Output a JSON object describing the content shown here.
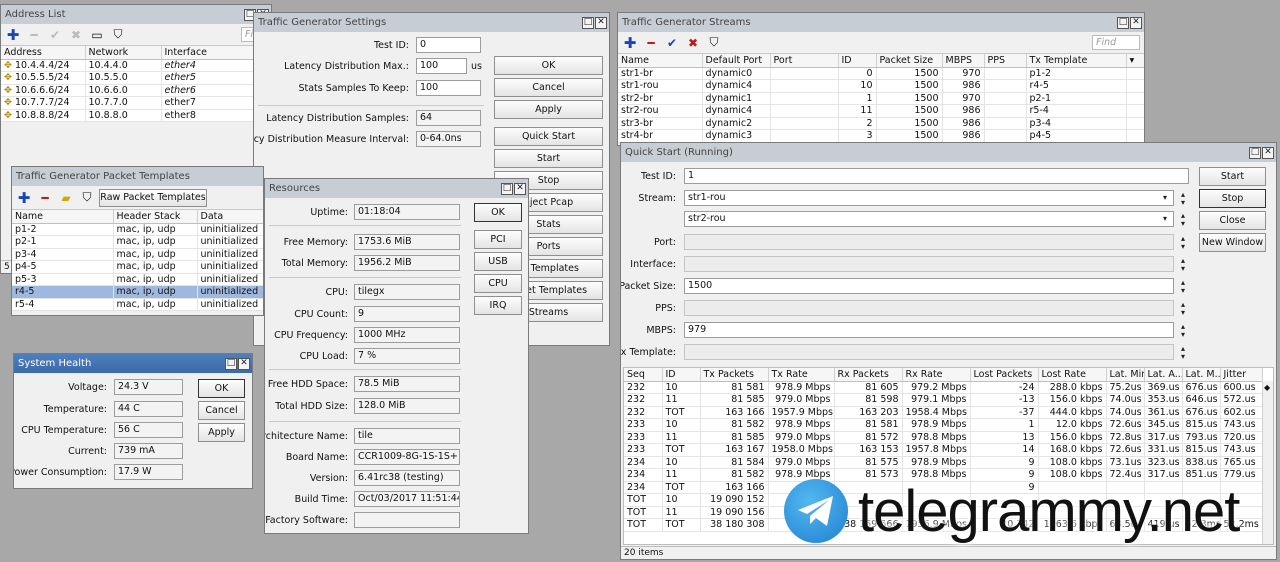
{
  "address_list": {
    "title": "Address List",
    "find": "Find",
    "columns": [
      "Address",
      "Network",
      "Interface"
    ],
    "rows": [
      {
        "address": "10.4.4.4/24",
        "network": "10.4.4.0",
        "interface": "ether4"
      },
      {
        "address": "10.5.5.5/24",
        "network": "10.5.5.0",
        "interface": "ether5"
      },
      {
        "address": "10.6.6.6/24",
        "network": "10.6.6.0",
        "interface": "ether6"
      },
      {
        "address": "10.7.7.7/24",
        "network": "10.7.7.0",
        "interface": "ether7"
      },
      {
        "address": "10.8.8.8/24",
        "network": "10.8.8.0",
        "interface": "ether8"
      }
    ],
    "status_char": "5"
  },
  "tg_settings": {
    "title": "Traffic Generator Settings",
    "test_id_label": "Test ID:",
    "test_id": "0",
    "latency_max_label": "Latency Distribution Max.:",
    "latency_max": "100",
    "latency_max_unit": "us",
    "stats_samples_label": "Stats Samples To Keep:",
    "stats_samples": "100",
    "latency_samples_label": "Latency Distribution Samples:",
    "latency_samples": "64",
    "latency_interval_label": "Latency Distribution Measure Interval:",
    "latency_interval": "0-64.0ns",
    "buttons": {
      "ok": "OK",
      "cancel": "Cancel",
      "apply": "Apply",
      "quick_start": "Quick Start",
      "start": "Start",
      "stop": "Stop",
      "inject_pcap": "nject Pcap",
      "stats": "Stats",
      "ports": "Ports",
      "packet_templates": "et Templates",
      "raw_packet_templates": "acket Templates",
      "streams": "Streams"
    }
  },
  "tg_streams": {
    "title": "Traffic Generator Streams",
    "find": "Find",
    "columns": [
      "Name",
      "Default Port",
      "Port",
      "ID",
      "Packet Size",
      "MBPS",
      "PPS",
      "Tx Template"
    ],
    "rows": [
      {
        "name": "str1-br",
        "default_port": "dynamic0",
        "port": "",
        "id": "0",
        "size": "1500",
        "mbps": "970",
        "pps": "",
        "tpl": "p1-2"
      },
      {
        "name": "str1-rou",
        "default_port": "dynamic4",
        "port": "",
        "id": "10",
        "size": "1500",
        "mbps": "986",
        "pps": "",
        "tpl": "r4-5"
      },
      {
        "name": "str2-br",
        "default_port": "dynamic1",
        "port": "",
        "id": "1",
        "size": "1500",
        "mbps": "970",
        "pps": "",
        "tpl": "p2-1"
      },
      {
        "name": "str2-rou",
        "default_port": "dynamic4",
        "port": "",
        "id": "11",
        "size": "1500",
        "mbps": "986",
        "pps": "",
        "tpl": "r5-4"
      },
      {
        "name": "str3-br",
        "default_port": "dynamic2",
        "port": "",
        "id": "2",
        "size": "1500",
        "mbps": "986",
        "pps": "",
        "tpl": "p3-4"
      },
      {
        "name": "str4-br",
        "default_port": "dynamic3",
        "port": "",
        "id": "3",
        "size": "1500",
        "mbps": "986",
        "pps": "",
        "tpl": "p4-5"
      }
    ]
  },
  "packet_templates": {
    "title": "Traffic Generator Packet Templates",
    "raw_button": "Raw Packet Templates",
    "columns": [
      "Name",
      "Header Stack",
      "Data"
    ],
    "rows": [
      {
        "name": "p1-2",
        "stack": "mac, ip, udp",
        "data": "uninitialized"
      },
      {
        "name": "p2-1",
        "stack": "mac, ip, udp",
        "data": "uninitialized"
      },
      {
        "name": "p3-4",
        "stack": "mac, ip, udp",
        "data": "uninitialized"
      },
      {
        "name": "p4-5",
        "stack": "mac, ip, udp",
        "data": "uninitialized"
      },
      {
        "name": "p5-3",
        "stack": "mac, ip, udp",
        "data": "uninitialized"
      },
      {
        "name": "r4-5",
        "stack": "mac, ip, udp",
        "data": "uninitialized"
      },
      {
        "name": "r5-4",
        "stack": "mac, ip, udp",
        "data": "uninitialized"
      }
    ]
  },
  "system_health": {
    "title": "System Health",
    "voltage_label": "Voltage:",
    "voltage": "24.3 V",
    "temperature_label": "Temperature:",
    "temperature": "44 C",
    "cpu_temp_label": "CPU Temperature:",
    "cpu_temp": "56 C",
    "current_label": "Current:",
    "current": "739 mA",
    "power_label": "Power Consumption:",
    "power": "17.9 W",
    "buttons": {
      "ok": "OK",
      "cancel": "Cancel",
      "apply": "Apply"
    }
  },
  "resources": {
    "title": "Resources",
    "uptime_label": "Uptime:",
    "uptime": "01:18:04",
    "free_mem_label": "Free Memory:",
    "free_mem": "1753.6 MiB",
    "total_mem_label": "Total Memory:",
    "total_mem": "1956.2 MiB",
    "cpu_label": "CPU:",
    "cpu": "tilegx",
    "cpu_count_label": "CPU Count:",
    "cpu_count": "9",
    "cpu_freq_label": "CPU Frequency:",
    "cpu_freq": "1000 MHz",
    "cpu_load_label": "CPU Load:",
    "cpu_load": "7 %",
    "free_hdd_label": "Free HDD Space:",
    "free_hdd": "78.5 MiB",
    "total_hdd_label": "Total HDD Size:",
    "total_hdd": "128.0 MiB",
    "arch_label": "Architecture Name:",
    "arch": "tile",
    "board_label": "Board Name:",
    "board": "CCR1009-8G-1S-1S+",
    "version_label": "Version:",
    "version": "6.41rc38 (testing)",
    "build_label": "Build Time:",
    "build": "Oct/03/2017 11:51:44",
    "factory_label": "Factory Software:",
    "factory": "",
    "buttons": {
      "ok": "OK",
      "pci": "PCI",
      "usb": "USB",
      "cpu": "CPU",
      "irq": "IRQ"
    }
  },
  "quick_start": {
    "title": "Quick Start (Running)",
    "test_id_label": "Test ID:",
    "test_id": "1",
    "stream_label": "Stream:",
    "stream1": "str1-rou",
    "stream2": "str2-rou",
    "port_label": "Port:",
    "interface_label": "Interface:",
    "packet_size_label": "Packet Size:",
    "packet_size": "1500",
    "pps_label": "PPS:",
    "mbps_label": "MBPS:",
    "mbps": "979",
    "tx_template_label": "Tx Template:",
    "buttons": {
      "start": "Start",
      "stop": "Stop",
      "close": "Close",
      "new_window": "New Window"
    },
    "columns": [
      "Seq",
      "ID",
      "Tx Packets",
      "Tx Rate",
      "Rx Packets",
      "Rx Rate",
      "Lost Packets",
      "Lost Rate",
      "Lat. Min.",
      "Lat. A...",
      "Lat. M...",
      "Jitter"
    ],
    "rows": [
      [
        "232",
        "10",
        "81 581",
        "978.9 Mbps",
        "81 605",
        "979.2 Mbps",
        "-24",
        "288.0 kbps",
        "75.2us",
        "369.us",
        "676.us",
        "600.us"
      ],
      [
        "232",
        "11",
        "81 585",
        "979.0 Mbps",
        "81 598",
        "979.1 Mbps",
        "-13",
        "156.0 kbps",
        "74.0us",
        "353.us",
        "646.us",
        "572.us"
      ],
      [
        "232",
        "TOT",
        "163 166",
        "1957.9 Mbps",
        "163 203",
        "1958.4 Mbps",
        "-37",
        "444.0 kbps",
        "74.0us",
        "361.us",
        "676.us",
        "602.us"
      ],
      [
        "233",
        "10",
        "81 582",
        "978.9 Mbps",
        "81 581",
        "978.9 Mbps",
        "1",
        "12.0 kbps",
        "72.6us",
        "345.us",
        "815.us",
        "743.us"
      ],
      [
        "233",
        "11",
        "81 585",
        "979.0 Mbps",
        "81 572",
        "978.8 Mbps",
        "13",
        "156.0 kbps",
        "72.8us",
        "317.us",
        "793.us",
        "720.us"
      ],
      [
        "233",
        "TOT",
        "163 167",
        "1958.0 Mbps",
        "163 153",
        "1957.8 Mbps",
        "14",
        "168.0 kbps",
        "72.6us",
        "331.us",
        "815.us",
        "743.us"
      ],
      [
        "234",
        "10",
        "81 584",
        "979.0 Mbps",
        "81 575",
        "978.9 Mbps",
        "9",
        "108.0 kbps",
        "73.1us",
        "323.us",
        "838.us",
        "765.us"
      ],
      [
        "234",
        "11",
        "81 582",
        "978.9 Mbps",
        "81 573",
        "978.8 Mbps",
        "9",
        "108.0 kbps",
        "72.4us",
        "317.us",
        "851.us",
        "779.us"
      ],
      [
        "234",
        "TOT",
        "163 166",
        "",
        "",
        "",
        "9",
        "",
        "",
        "",
        "",
        ""
      ],
      [
        "TOT",
        "10",
        "19 090 152",
        "",
        "",
        "",
        "",
        "",
        "",
        "",
        "",
        ""
      ],
      [
        "TOT",
        "11",
        "19 090 156",
        "",
        "",
        "",
        "",
        "",
        "",
        "",
        "",
        ""
      ],
      [
        "TOT",
        "TOT",
        "38 180 308",
        "",
        "38 159 566",
        "1956.9 Mbps",
        "20 742",
        "1063.6 kbps",
        "68.5us",
        "419.us",
        "52.3ms",
        "52.2ms"
      ]
    ],
    "status": "20 items"
  },
  "watermark": {
    "text": "telegrammy.net"
  }
}
